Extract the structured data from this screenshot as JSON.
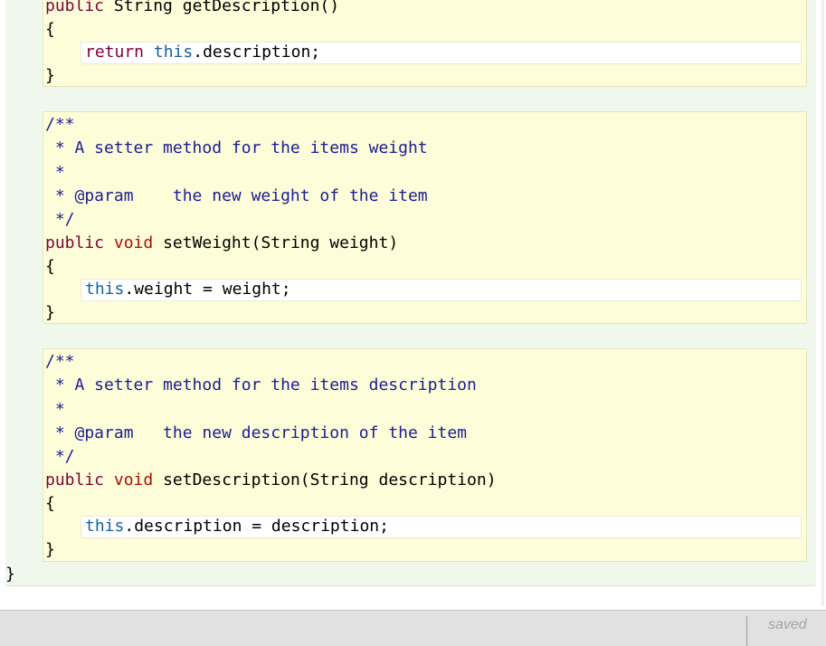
{
  "methods": [
    {
      "signature": [
        "public",
        " String getDescription()"
      ],
      "open_brace": "{",
      "body": [
        "return",
        "this",
        ".description;"
      ],
      "close_brace": "}"
    },
    {
      "comment": [
        "/**",
        " * A setter method for the items weight",
        " *",
        " * @param    the new weight of the item",
        " */"
      ],
      "signature": [
        "public",
        "void",
        " setWeight(String weight)"
      ],
      "open_brace": "{",
      "body": [
        "this",
        ".weight = weight;"
      ],
      "close_brace": "}"
    },
    {
      "comment": [
        "/**",
        " * A setter method for the items description",
        " *",
        " * @param   the new description of the item",
        " */"
      ],
      "signature": [
        "public",
        "void",
        " setDescription(String description)"
      ],
      "open_brace": "{",
      "body": [
        "this",
        ".description = description;"
      ],
      "close_brace": "}"
    }
  ],
  "class_close_brace": "}",
  "status": {
    "saved_label": "saved"
  },
  "colors": {
    "class_bg": "#f0f7ec",
    "method_bg": "#fdfdd9",
    "keyword": "#7f0035",
    "this_keyword": "#14639e",
    "comment": "#1c1c93"
  }
}
